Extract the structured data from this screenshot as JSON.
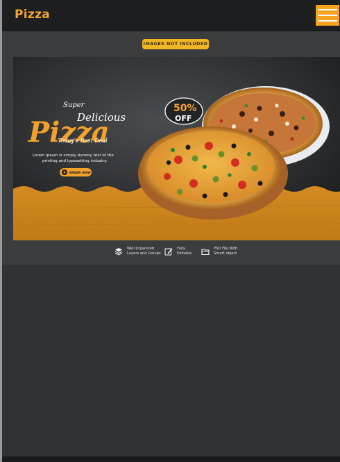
{
  "header": {
    "brand": "Pizza",
    "menu_icon": "hamburger-menu-icon"
  },
  "preview": {
    "notice": "IMAGES NOT INCLUDED",
    "banner": {
      "headline_super": "Super",
      "headline_delicious": "Delicious",
      "headline_pizza": "Pizza",
      "headline_deal": "Today's Best Deal",
      "description_line1": "Lorem Ipsum is simply dummy text of the",
      "description_line2": "printing and typesetting industry.",
      "order_button": "ORDER NOW",
      "discount_percent": "50%",
      "discount_off": "OFF"
    },
    "features": [
      {
        "icon": "layers-icon",
        "line1": "Well Organized",
        "line2": "Layers and Groups"
      },
      {
        "icon": "edit-icon",
        "line1": "Fully",
        "line2": "Editable"
      },
      {
        "icon": "folder-icon",
        "line1": "PSD File With",
        "line2": "Smart object"
      }
    ]
  },
  "colors": {
    "accent": "#f6a21d",
    "brand_text": "#f3a62c",
    "header_bg": "#1d1e1f",
    "page_bg": "#2d2f30"
  }
}
